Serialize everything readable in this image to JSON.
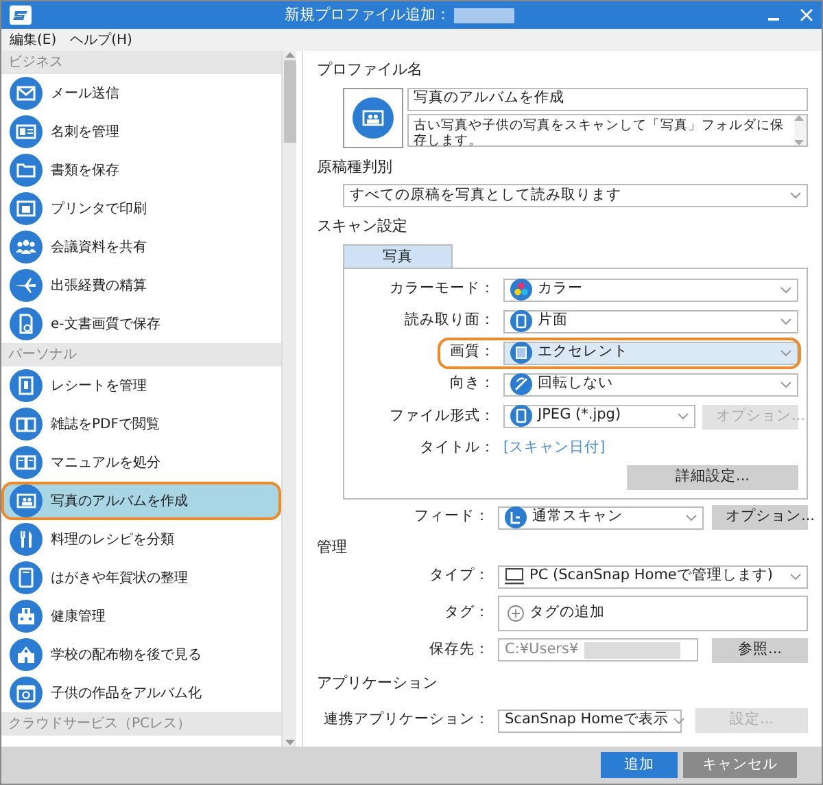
{
  "window": {
    "title": "新規プロファイル追加："
  },
  "menu": [
    "編集(E)",
    "ヘルプ(H)"
  ],
  "sidebar": {
    "groups": [
      {
        "title": "ビジネス",
        "items": [
          {
            "label": "メール送信",
            "selected": false,
            "highlighted": false
          },
          {
            "label": "名刺を管理",
            "selected": false,
            "highlighted": false
          },
          {
            "label": "書類を保存",
            "selected": false,
            "highlighted": false
          },
          {
            "label": "プリンタで印刷",
            "selected": false,
            "highlighted": false
          },
          {
            "label": "会議資料を共有",
            "selected": false,
            "highlighted": false
          },
          {
            "label": "出張経費の精算",
            "selected": false,
            "highlighted": false
          },
          {
            "label": "e-文書画質で保存",
            "selected": false,
            "highlighted": false
          }
        ]
      },
      {
        "title": "パーソナル",
        "items": [
          {
            "label": "レシートを管理",
            "selected": false,
            "highlighted": false
          },
          {
            "label": "雑誌をPDFで閲覧",
            "selected": false,
            "highlighted": false
          },
          {
            "label": "マニュアルを処分",
            "selected": false,
            "highlighted": false
          },
          {
            "label": "写真のアルバムを作成",
            "selected": true,
            "highlighted": true
          },
          {
            "label": "料理のレシピを分類",
            "selected": false,
            "highlighted": false
          },
          {
            "label": "はがきや年賀状の整理",
            "selected": false,
            "highlighted": false
          },
          {
            "label": "健康管理",
            "selected": false,
            "highlighted": false
          },
          {
            "label": "学校の配布物を後で見る",
            "selected": false,
            "highlighted": false
          },
          {
            "label": "子供の作品をアルバム化",
            "selected": false,
            "highlighted": false
          }
        ]
      },
      {
        "title": "クラウドサービス（PCレス）"
      }
    ]
  },
  "profile": {
    "name_label": "プロファイル名",
    "name": "写真のアルバムを作成",
    "description": "古い写真や子供の写真をスキャンして「写真」フォルダに保存します。"
  },
  "detection": {
    "label": "原稿種判別",
    "value": "すべての原稿を写真として読み取ります"
  },
  "scan_settings": {
    "label": "スキャン設定",
    "tabs": [
      {
        "label": "写真",
        "selected": true
      }
    ],
    "rows": [
      {
        "kind": "select",
        "label": "カラーモード：",
        "value": "カラー",
        "highlighted": false
      },
      {
        "kind": "select",
        "label": "読み取り面：",
        "value": "片面",
        "highlighted": false
      },
      {
        "kind": "select",
        "label": "画質：",
        "value": "エクセレント",
        "highlighted": true
      },
      {
        "kind": "select",
        "label": "向き：",
        "value": "回転しない",
        "highlighted": false
      },
      {
        "kind": "select",
        "label": "ファイル形式：",
        "value": "JPEG (*.jpg)",
        "highlighted": false,
        "button": {
          "label": "オプション...",
          "disabled": true
        }
      },
      {
        "kind": "link",
        "label": "タイトル：",
        "value": "[スキャン日付]",
        "highlighted": false
      }
    ],
    "detail_button": "詳細設定..."
  },
  "feed": {
    "label": "フィード：",
    "value": "通常スキャン",
    "button": {
      "label": "オプション...",
      "disabled": false
    }
  },
  "management": {
    "label": "管理",
    "type": {
      "label": "タイプ：",
      "value": "PC (ScanSnap Homeで管理します)"
    },
    "tag": {
      "label": "タグ：",
      "add": "タグの追加"
    },
    "save_to": {
      "label": "保存先：",
      "value": "C:¥Users¥",
      "button": "参照..."
    }
  },
  "application": {
    "label": "アプリケーション",
    "row": {
      "label": "連携アプリケーション：",
      "value": "ScanSnap Homeで表示",
      "button": {
        "label": "設定...",
        "disabled": true
      }
    }
  },
  "footer": {
    "buttons": [
      {
        "label": "追加",
        "kind": "primary"
      },
      {
        "label": "キャンセル",
        "kind": "secondary"
      }
    ]
  }
}
